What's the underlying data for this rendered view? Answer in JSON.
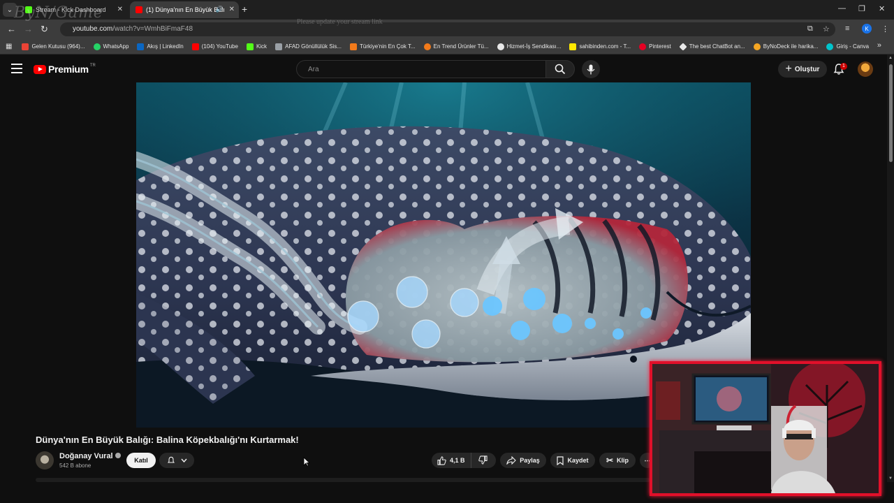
{
  "browser": {
    "tabs": [
      {
        "title": "Stream - Kick Dashboard",
        "favicon_color": "#53fc18"
      },
      {
        "title": "(1) Dünya'nın En Büyük Balı",
        "favicon_color": "#ff0000"
      }
    ],
    "url_host": "youtube.com",
    "url_path": "/watch?v=WmhBiFmaF48",
    "profile_initial": "K",
    "bookmarks": [
      {
        "label": "Gelen Kutusu (964)...",
        "color": "#ea4335"
      },
      {
        "label": "WhatsApp",
        "color": "#25d366"
      },
      {
        "label": "Akış | LinkedIn",
        "color": "#0a66c2"
      },
      {
        "label": "(104) YouTube",
        "color": "#ff0000"
      },
      {
        "label": "Kick",
        "color": "#53fc18"
      },
      {
        "label": "AFAD Gönüllülük Sis...",
        "color": "#9aa0a6"
      },
      {
        "label": "Türkiye'nin En Çok T...",
        "color": "#f27a1a"
      },
      {
        "label": "En Trend Ürünler Tü...",
        "color": "#f27a1a"
      },
      {
        "label": "Hizmet-İş Sendikası...",
        "color": "#e8e8e8"
      },
      {
        "label": "sahibinden.com - T...",
        "color": "#ffe800"
      },
      {
        "label": "Pinterest",
        "color": "#e60023"
      },
      {
        "label": "The best ChatBot an...",
        "color": "#e8e8e8"
      },
      {
        "label": "ByNoDeck ile harika...",
        "color": "#f5a623"
      },
      {
        "label": "Giriş - Canva",
        "color": "#00c4cc"
      }
    ]
  },
  "youtube": {
    "logo_text": "Premium",
    "country": "TR",
    "search_placeholder": "Ara",
    "create_label": "Oluştur",
    "notification_count": "1"
  },
  "video": {
    "title": "Dünya'nın En Büyük Balığı: Balina Köpekbalığı'nı Kurtarmak!",
    "channel": "Doğanay Vural",
    "subscribers": "542 B abone",
    "join_label": "Katıl",
    "likes": "4,1 B",
    "share_label": "Paylaş",
    "save_label": "Kaydet",
    "clip_label": "Klip"
  },
  "overlay": {
    "watermark_logo": "ByN/Game",
    "watermark_notice": "Please update your stream link"
  },
  "colors": {
    "yt_red": "#ff0000",
    "webcam_border": "#e1102a",
    "background": "#0f0f0f"
  }
}
